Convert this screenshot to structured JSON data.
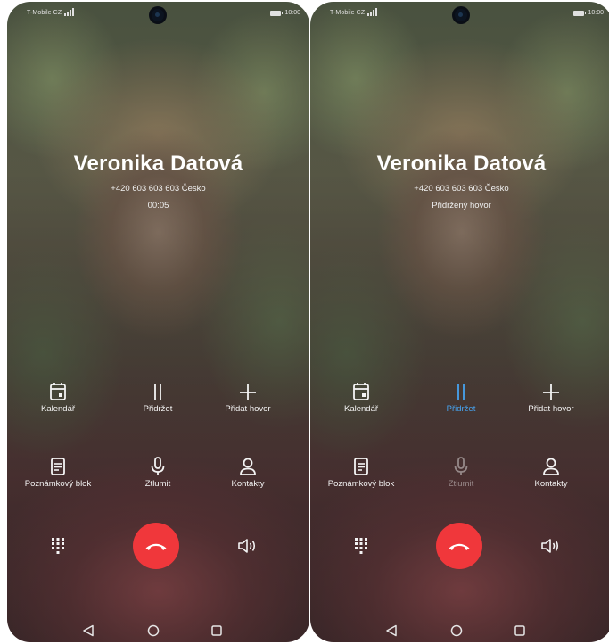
{
  "screens": [
    {
      "status_bar": {
        "carrier": "T-Mobile CZ",
        "time": "10:00"
      },
      "caller": {
        "name": "Veronika Datová",
        "number": "+420 603 603 603  Česko",
        "status": "00:05"
      },
      "buttons": {
        "calendar": "Kalendář",
        "hold": "Přidržet",
        "add_call": "Přidat hovor",
        "notepad": "Poznámkový blok",
        "mute": "Ztlumit",
        "contacts": "Kontakty"
      },
      "hold_active": false
    },
    {
      "status_bar": {
        "carrier": "T-Mobile CZ",
        "time": "10:00"
      },
      "caller": {
        "name": "Veronika Datová",
        "number": "+420 603 603 603  Česko",
        "status": "Přidržený hovor"
      },
      "buttons": {
        "calendar": "Kalendář",
        "hold": "Přidržet",
        "add_call": "Přidat hovor",
        "notepad": "Poznámkový blok",
        "mute": "Ztlumit",
        "contacts": "Kontakty"
      },
      "hold_active": true
    }
  ],
  "icons": {
    "calendar": "calendar-icon",
    "hold": "pause-icon",
    "add_call": "plus-icon",
    "notepad": "notepad-icon",
    "mute": "microphone-icon",
    "contacts": "person-icon",
    "dialpad": "dialpad-icon",
    "end_call": "end-call-icon",
    "speaker": "speaker-icon",
    "back": "back-triangle-icon",
    "home": "home-circle-icon",
    "recents": "recents-square-icon"
  },
  "colors": {
    "end_call": "#f0373b",
    "active_accent": "#46a3f0",
    "text": "#ffffff"
  }
}
